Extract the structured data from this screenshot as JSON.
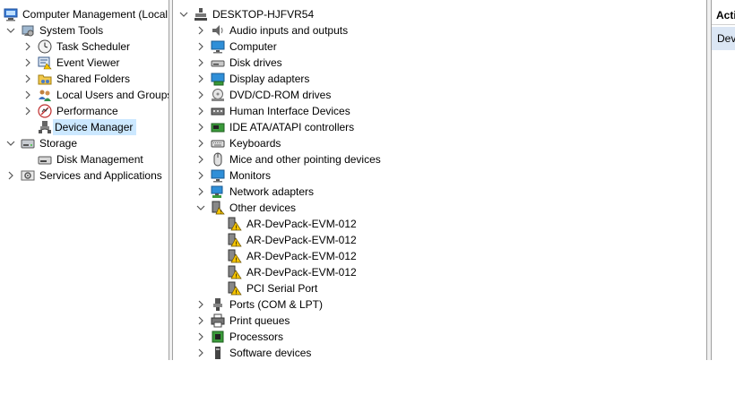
{
  "left_tree": {
    "root_label": "Computer Management (Local",
    "system_tools_label": "System Tools",
    "task_scheduler_label": "Task Scheduler",
    "event_viewer_label": "Event Viewer",
    "shared_folders_label": "Shared Folders",
    "local_users_label": "Local Users and Groups",
    "performance_label": "Performance",
    "device_manager_label": "Device Manager",
    "storage_label": "Storage",
    "disk_management_label": "Disk Management",
    "services_label": "Services and Applications"
  },
  "device_tree": {
    "root_label": "DESKTOP-HJFVR54",
    "categories": [
      "Audio inputs and outputs",
      "Computer",
      "Disk drives",
      "Display adapters",
      "DVD/CD-ROM drives",
      "Human Interface Devices",
      "IDE ATA/ATAPI controllers",
      "Keyboards",
      "Mice and other pointing devices",
      "Monitors",
      "Network adapters",
      "Other devices"
    ],
    "other_devices": [
      "AR-DevPack-EVM-012",
      "AR-DevPack-EVM-012",
      "AR-DevPack-EVM-012",
      "AR-DevPack-EVM-012",
      "PCI Serial Port"
    ],
    "categories_after": [
      "Ports (COM & LPT)",
      "Print queues",
      "Processors",
      "Software devices"
    ]
  },
  "actions": {
    "header": "Acti",
    "item": "Dev"
  },
  "colors": {
    "selection": "#cce8ff",
    "actions_item_bg": "#dbe6f4",
    "warning": "#f5c400"
  },
  "icons": {
    "expanded": "chevron-down-icon",
    "collapsed": "chevron-right-icon"
  }
}
